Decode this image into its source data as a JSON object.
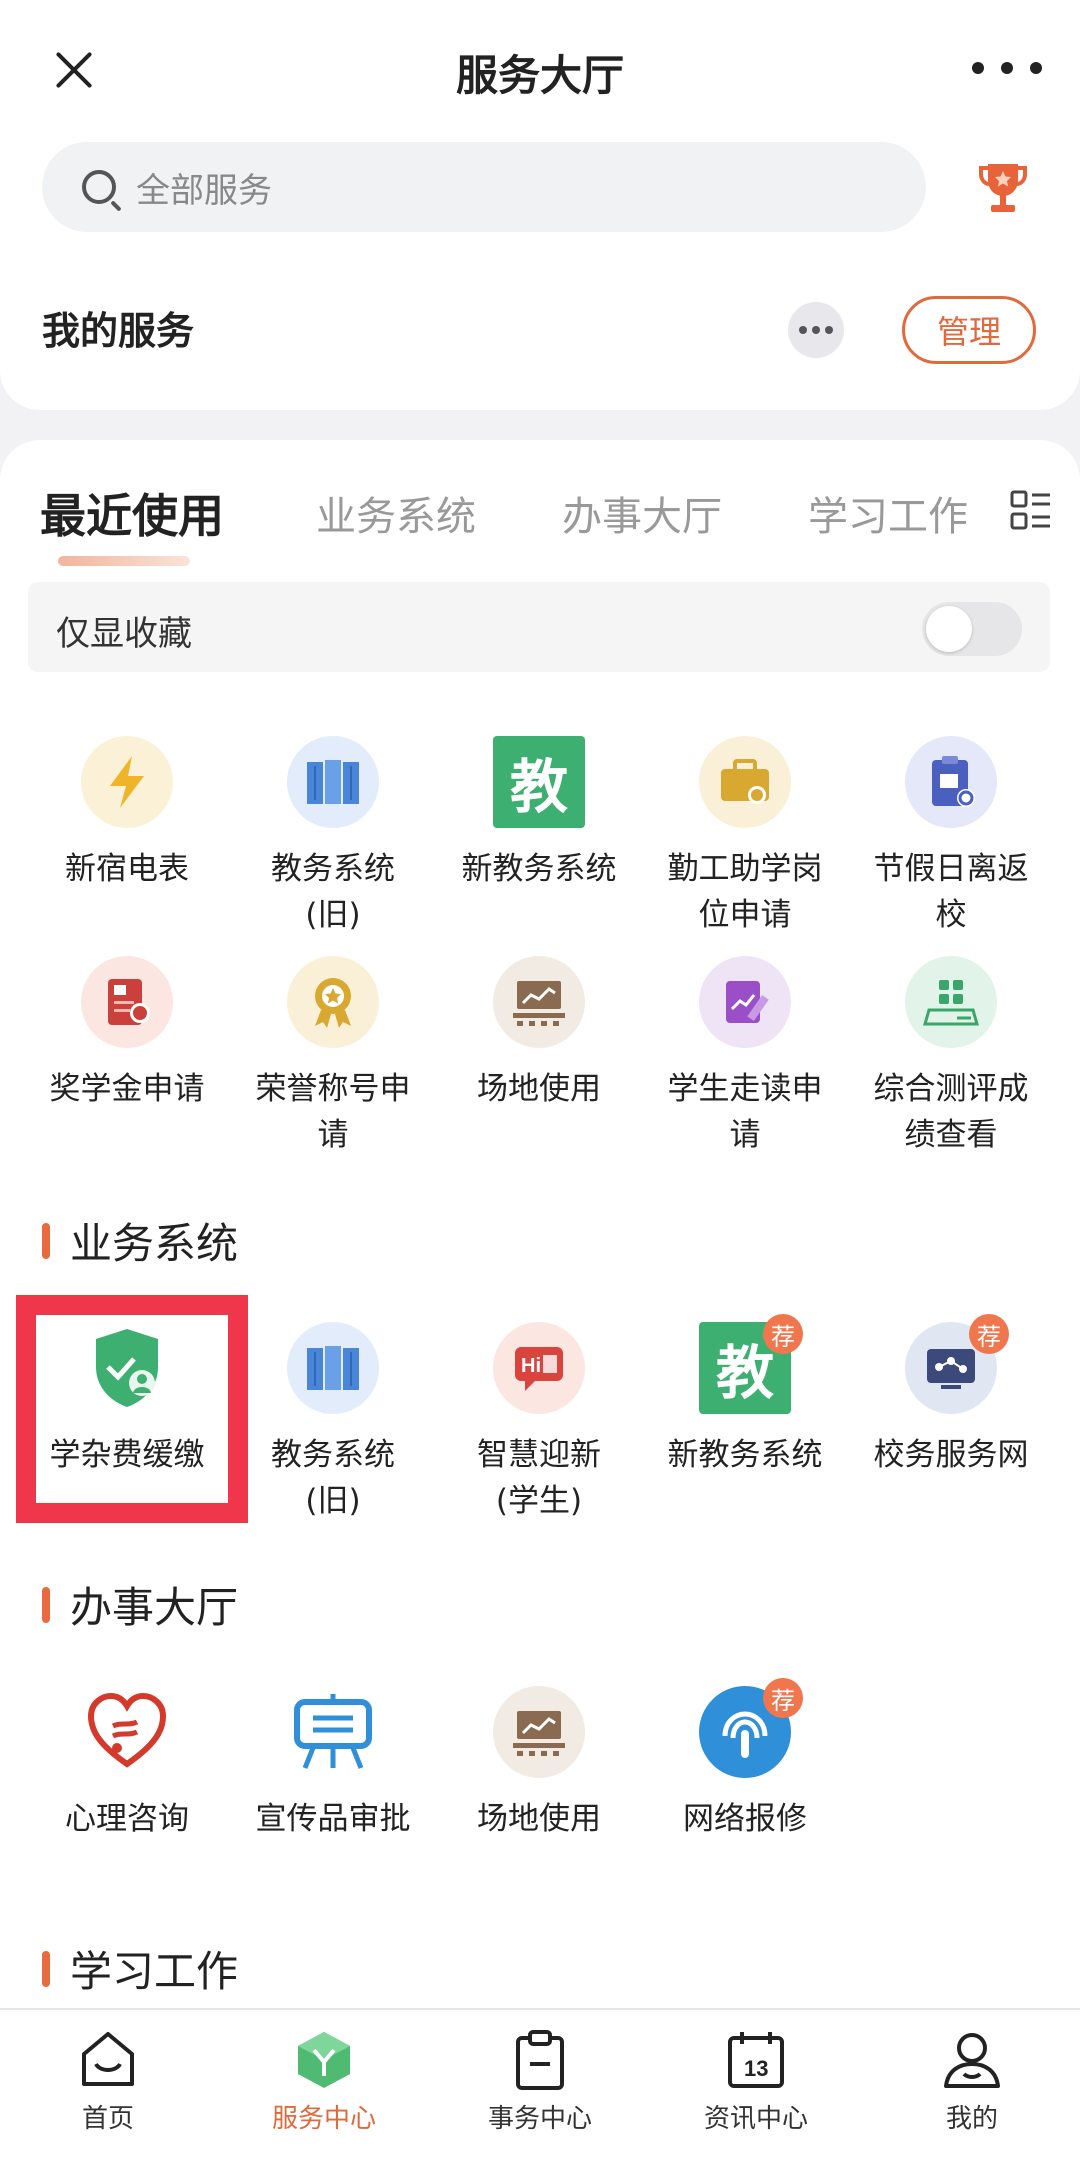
{
  "header": {
    "title": "服务大厅"
  },
  "search": {
    "placeholder": "全部服务"
  },
  "my_services": {
    "label": "我的服务",
    "manage_label": "管理"
  },
  "tabs": [
    {
      "label": "最近使用",
      "active": true
    },
    {
      "label": "业务系统",
      "active": false
    },
    {
      "label": "办事大厅",
      "active": false
    },
    {
      "label": "学习工作",
      "active": false
    }
  ],
  "favorites_toggle": {
    "label": "仅显示收藏",
    "label_shown": "仅显收藏",
    "on": false
  },
  "recent_apps": [
    {
      "label": "新宿电表",
      "icon": "lightning-icon"
    },
    {
      "label": "教务系统\n(旧)",
      "icon": "books-icon"
    },
    {
      "label": "新教务系统",
      "icon": "jiao-icon"
    },
    {
      "label": "勤工助学岗\n位申请",
      "icon": "briefcase-icon"
    },
    {
      "label": "节假日离返\n校",
      "icon": "clipboard-icon"
    },
    {
      "label": "奖学金申请",
      "icon": "scholarship-icon"
    },
    {
      "label": "荣誉称号申\n请",
      "icon": "medal-icon"
    },
    {
      "label": "场地使用",
      "icon": "stage-icon"
    },
    {
      "label": "学生走读申\n请",
      "icon": "edit-doc-icon"
    },
    {
      "label": "综合测评成\n绩查看",
      "icon": "grade-icon"
    }
  ],
  "sections": {
    "business": "业务系统",
    "affairs": "办事大厅",
    "study": "学习工作"
  },
  "business_apps": [
    {
      "label": "学杂费缓缴",
      "icon": "shield-user-icon"
    },
    {
      "label": "教务系统\n(旧)",
      "icon": "books-icon"
    },
    {
      "label": "智慧迎新\n(学生)",
      "icon": "welcome-icon"
    },
    {
      "label": "新教务系统",
      "icon": "jiao-icon",
      "badge": "荐"
    },
    {
      "label": "校务服务网",
      "icon": "network-icon",
      "badge": "荐"
    }
  ],
  "affairs_apps": [
    {
      "label": "心理咨询",
      "icon": "heart-icon"
    },
    {
      "label": "宣传品审批",
      "icon": "easel-icon"
    },
    {
      "label": "场地使用",
      "icon": "stage-icon"
    },
    {
      "label": "网络报修",
      "icon": "signal-icon",
      "badge": "荐"
    }
  ],
  "bottom_nav": [
    {
      "label": "首页",
      "icon": "home-icon"
    },
    {
      "label": "服务中心",
      "icon": "service-cube-icon",
      "active": true
    },
    {
      "label": "事务中心",
      "icon": "clipboard-nav-icon"
    },
    {
      "label": "资讯中心",
      "icon": "calendar-icon"
    },
    {
      "label": "我的",
      "icon": "person-icon"
    }
  ],
  "colors": {
    "accent": "#e06a3c",
    "highlight_box": "#f0364a",
    "jiao_green": "#3db071"
  }
}
